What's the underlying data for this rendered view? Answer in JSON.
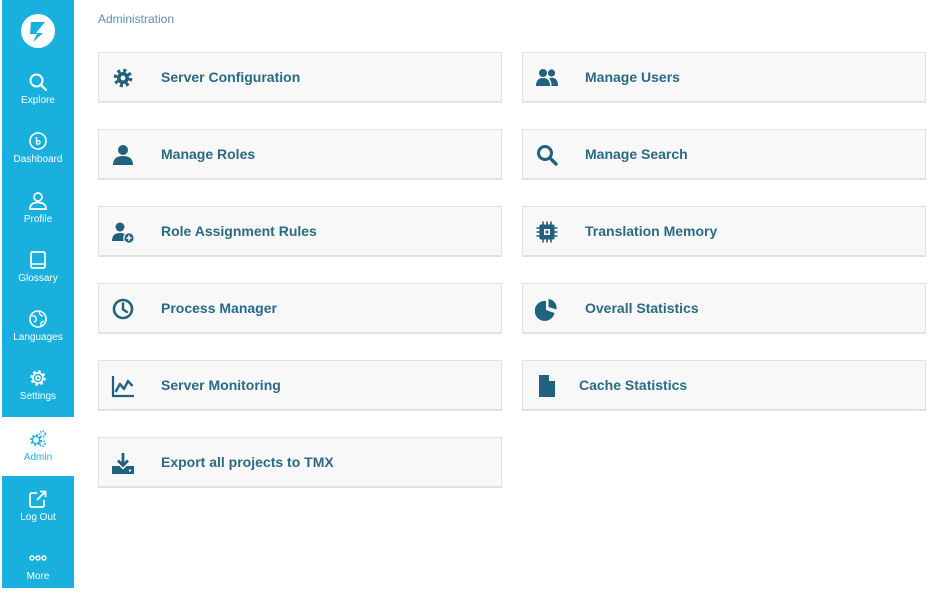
{
  "sidebar": {
    "items": [
      {
        "label": "Explore",
        "icon": "search-icon"
      },
      {
        "label": "Dashboard",
        "icon": "dashboard-icon"
      },
      {
        "label": "Profile",
        "icon": "user-icon"
      },
      {
        "label": "Glossary",
        "icon": "book-icon"
      },
      {
        "label": "Languages",
        "icon": "globe-icon"
      },
      {
        "label": "Settings",
        "icon": "gear-icon"
      },
      {
        "label": "Admin",
        "icon": "gears-icon",
        "active": true
      },
      {
        "label": "Log Out",
        "icon": "logout-icon"
      },
      {
        "label": "More",
        "icon": "more-icon"
      }
    ]
  },
  "breadcrumb": "Administration",
  "cards": [
    {
      "label": "Server Configuration",
      "icon": "gear-icon"
    },
    {
      "label": "Manage Users",
      "icon": "users-icon"
    },
    {
      "label": "Manage Roles",
      "icon": "user-icon"
    },
    {
      "label": "Manage Search",
      "icon": "search-icon"
    },
    {
      "label": "Role Assignment Rules",
      "icon": "user-add-icon"
    },
    {
      "label": "Translation Memory",
      "icon": "chip-icon"
    },
    {
      "label": "Process Manager",
      "icon": "clock-icon"
    },
    {
      "label": "Overall Statistics",
      "icon": "pie-chart-icon"
    },
    {
      "label": "Server Monitoring",
      "icon": "line-chart-icon"
    },
    {
      "label": "Cache Statistics",
      "icon": "document-icon"
    },
    {
      "label": "Export all projects to TMX",
      "icon": "download-icon"
    }
  ],
  "colors": {
    "sidebar": "#1ab0de",
    "accent_text": "#2a6a85",
    "icon": "#20627d",
    "card_bg": "#f8f8f8",
    "breadcrumb": "#5e8fa8"
  }
}
